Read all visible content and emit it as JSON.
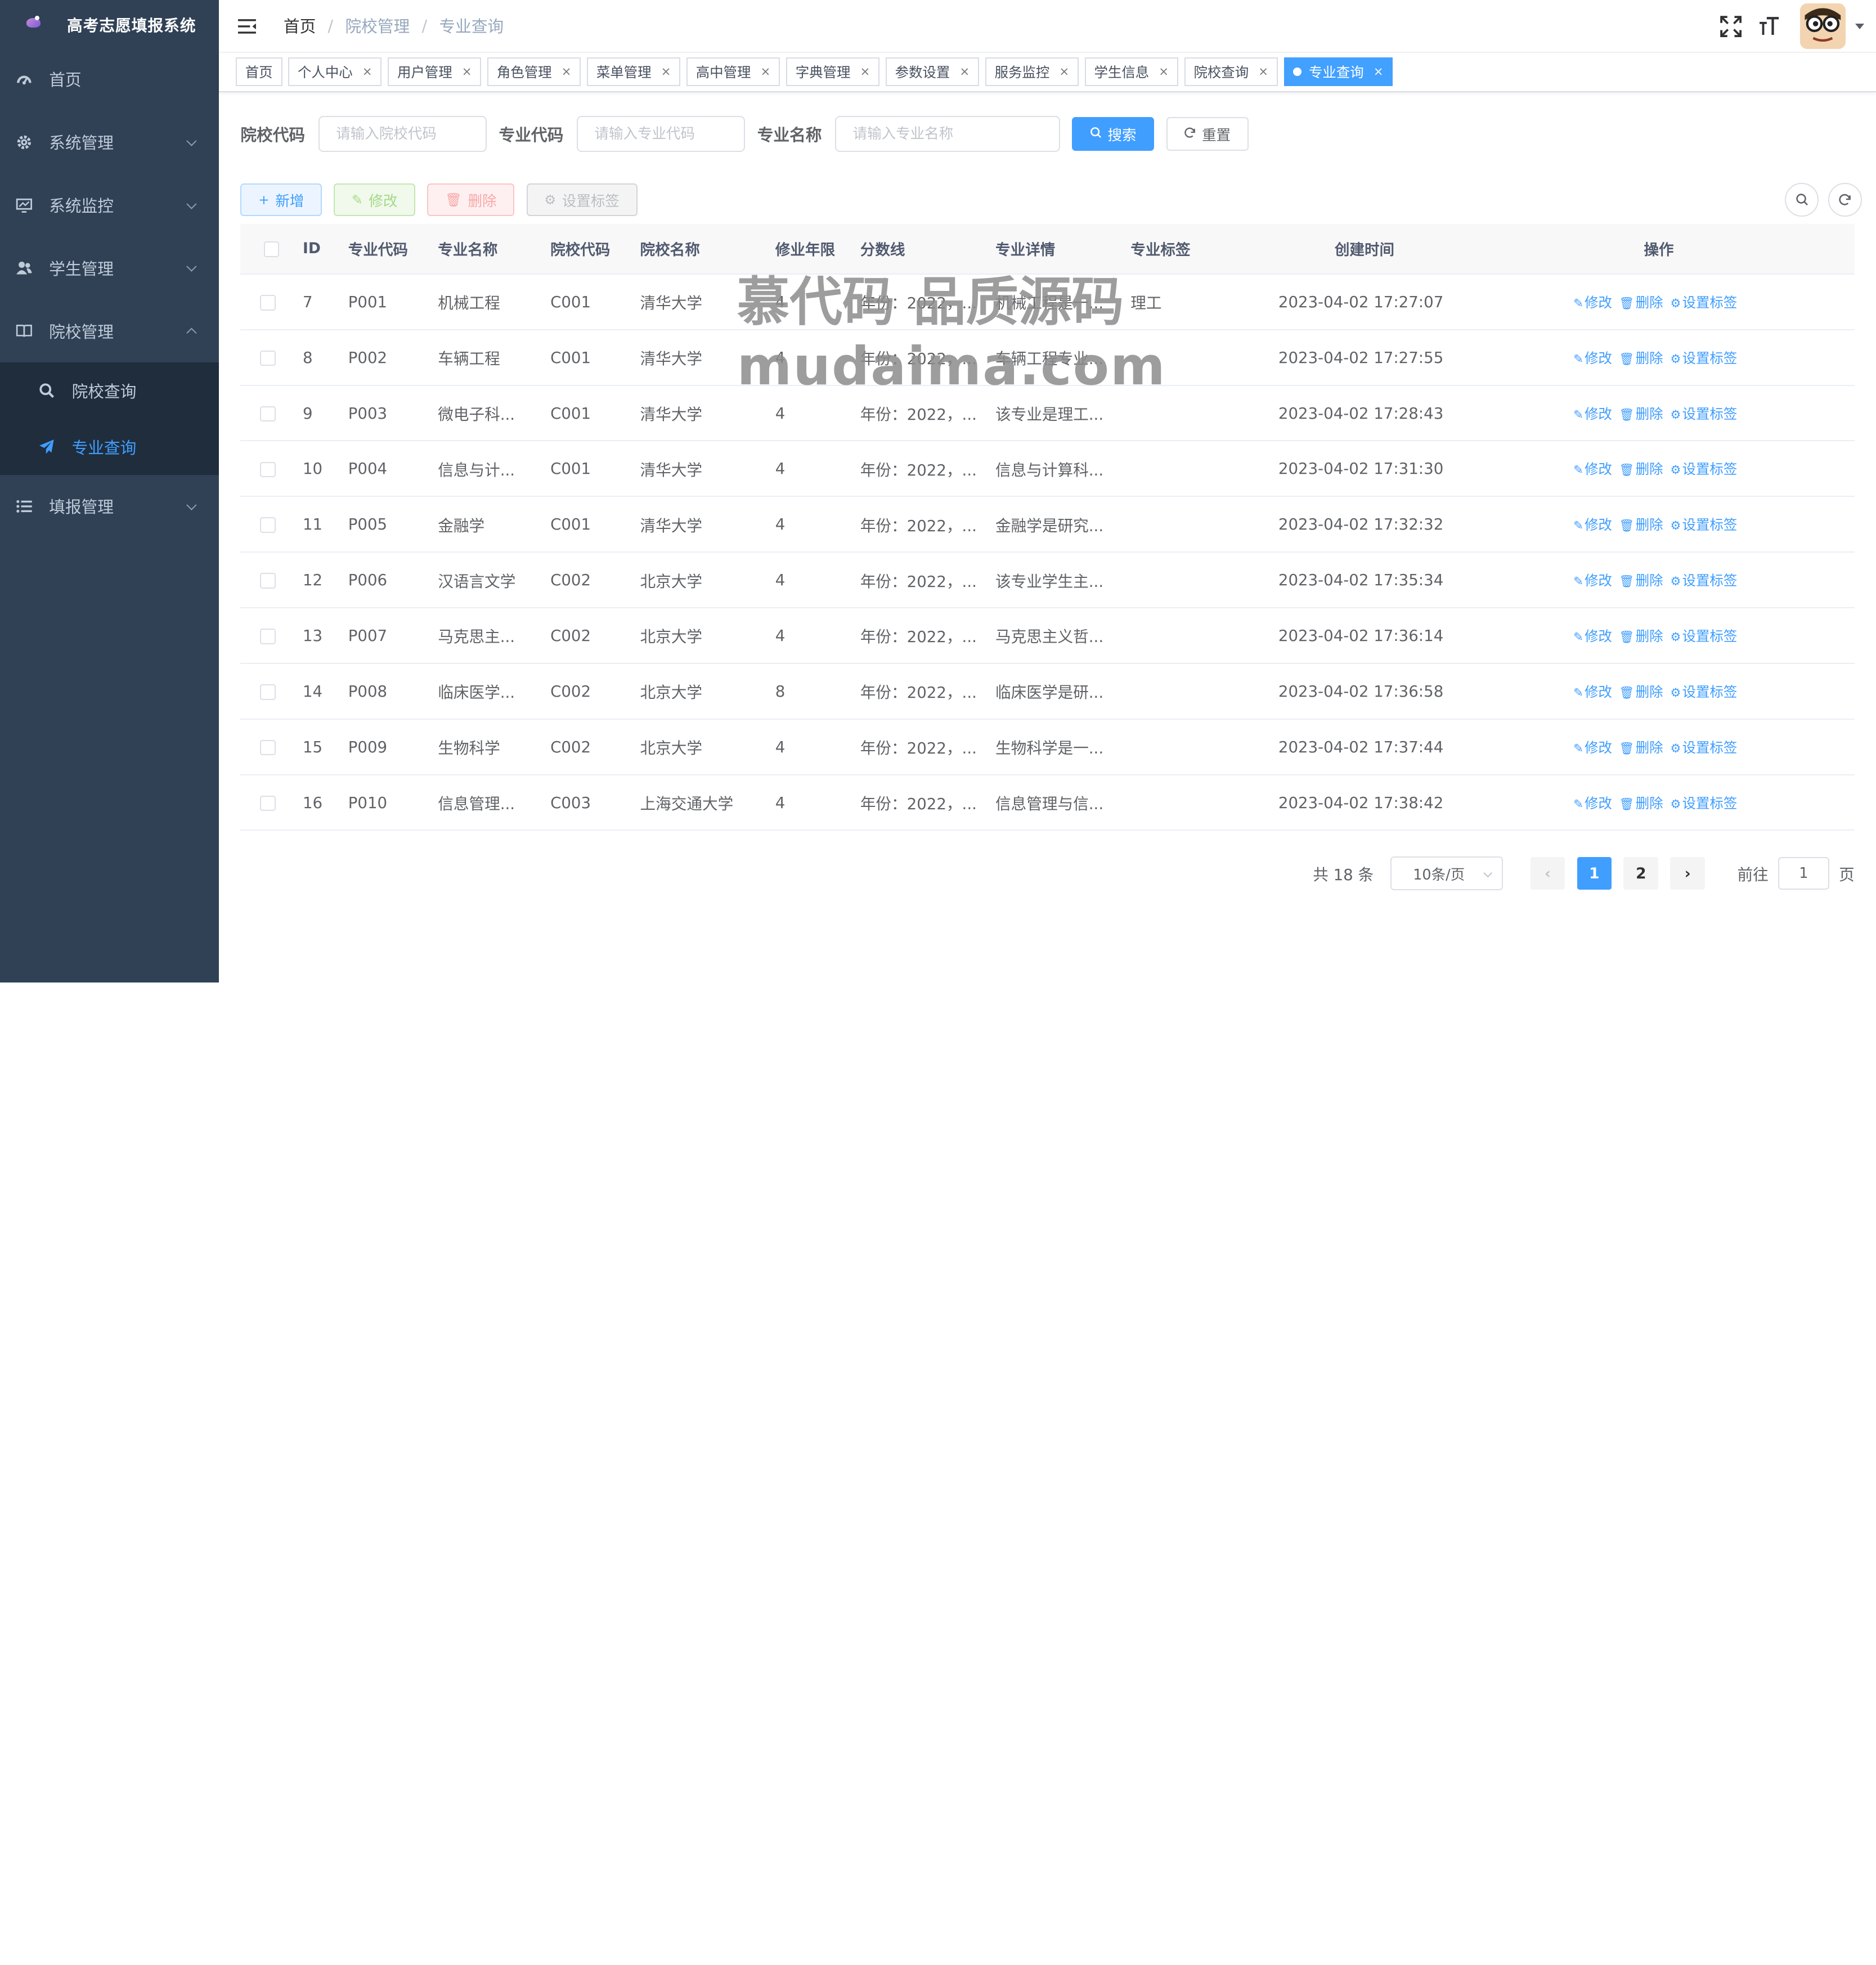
{
  "app": {
    "title": "高考志愿填报系统"
  },
  "sidebar": {
    "items": [
      {
        "label": "首页",
        "icon": "dashboard-icon",
        "has_children": false
      },
      {
        "label": "系统管理",
        "icon": "gear-icon",
        "has_children": true
      },
      {
        "label": "系统监控",
        "icon": "monitor-icon",
        "has_children": true
      },
      {
        "label": "学生管理",
        "icon": "users-icon",
        "has_children": true
      },
      {
        "label": "院校管理",
        "icon": "book-icon",
        "has_children": true,
        "expanded": true
      }
    ],
    "subitems": [
      {
        "label": "院校查询",
        "icon": "search-icon"
      },
      {
        "label": "专业查询",
        "icon": "send-icon",
        "active": true
      }
    ],
    "last_item": {
      "label": "填报管理",
      "icon": "list-icon"
    }
  },
  "breadcrumb": [
    "首页",
    "院校管理",
    "专业查询"
  ],
  "tags": [
    {
      "label": "首页",
      "closable": false
    },
    {
      "label": "个人中心",
      "closable": true
    },
    {
      "label": "用户管理",
      "closable": true
    },
    {
      "label": "角色管理",
      "closable": true
    },
    {
      "label": "菜单管理",
      "closable": true
    },
    {
      "label": "高中管理",
      "closable": true
    },
    {
      "label": "字典管理",
      "closable": true
    },
    {
      "label": "参数设置",
      "closable": true
    },
    {
      "label": "服务监控",
      "closable": true
    },
    {
      "label": "学生信息",
      "closable": true
    },
    {
      "label": "院校查询",
      "closable": true
    },
    {
      "label": "专业查询",
      "closable": true,
      "active": true
    }
  ],
  "search": {
    "school_code_label": "院校代码",
    "school_code_placeholder": "请输入院校代码",
    "major_code_label": "专业代码",
    "major_code_placeholder": "请输入专业代码",
    "major_name_label": "专业名称",
    "major_name_placeholder": "请输入专业名称",
    "search_button": "搜索",
    "reset_button": "重置"
  },
  "toolbar": {
    "add": "新增",
    "edit": "修改",
    "delete": "删除",
    "set_tag": "设置标签"
  },
  "table": {
    "columns": [
      "ID",
      "专业代码",
      "专业名称",
      "院校代码",
      "院校名称",
      "修业年限",
      "分数线",
      "专业详情",
      "专业标签",
      "创建时间",
      "操作"
    ],
    "rows": [
      {
        "id": "7",
        "major_code": "P001",
        "major_name": "机械工程",
        "school_code": "C001",
        "school_name": "清华大学",
        "years": "4",
        "score": "年份：2022，...",
        "detail": "机械工程是一...",
        "tag": "理工",
        "created": "2023-04-02 17:27:07"
      },
      {
        "id": "8",
        "major_code": "P002",
        "major_name": "车辆工程",
        "school_code": "C001",
        "school_name": "清华大学",
        "years": "4",
        "score": "年份：2022，...",
        "detail": "车辆工程专业...",
        "tag": "",
        "created": "2023-04-02 17:27:55"
      },
      {
        "id": "9",
        "major_code": "P003",
        "major_name": "微电子科...",
        "school_code": "C001",
        "school_name": "清华大学",
        "years": "4",
        "score": "年份：2022，...",
        "detail": "该专业是理工...",
        "tag": "",
        "created": "2023-04-02 17:28:43"
      },
      {
        "id": "10",
        "major_code": "P004",
        "major_name": "信息与计...",
        "school_code": "C001",
        "school_name": "清华大学",
        "years": "4",
        "score": "年份：2022，...",
        "detail": "信息与计算科...",
        "tag": "",
        "created": "2023-04-02 17:31:30"
      },
      {
        "id": "11",
        "major_code": "P005",
        "major_name": "金融学",
        "school_code": "C001",
        "school_name": "清华大学",
        "years": "4",
        "score": "年份：2022，...",
        "detail": "金融学是研究...",
        "tag": "",
        "created": "2023-04-02 17:32:32"
      },
      {
        "id": "12",
        "major_code": "P006",
        "major_name": "汉语言文学",
        "school_code": "C002",
        "school_name": "北京大学",
        "years": "4",
        "score": "年份：2022，...",
        "detail": "该专业学生主...",
        "tag": "",
        "created": "2023-04-02 17:35:34"
      },
      {
        "id": "13",
        "major_code": "P007",
        "major_name": "马克思主...",
        "school_code": "C002",
        "school_name": "北京大学",
        "years": "4",
        "score": "年份：2022，...",
        "detail": "马克思主义哲...",
        "tag": "",
        "created": "2023-04-02 17:36:14"
      },
      {
        "id": "14",
        "major_code": "P008",
        "major_name": "临床医学...",
        "school_code": "C002",
        "school_name": "北京大学",
        "years": "8",
        "score": "年份：2022，...",
        "detail": "临床医学是研...",
        "tag": "",
        "created": "2023-04-02 17:36:58"
      },
      {
        "id": "15",
        "major_code": "P009",
        "major_name": "生物科学",
        "school_code": "C002",
        "school_name": "北京大学",
        "years": "4",
        "score": "年份：2022，...",
        "detail": "生物科学是一...",
        "tag": "",
        "created": "2023-04-02 17:37:44"
      },
      {
        "id": "16",
        "major_code": "P010",
        "major_name": "信息管理...",
        "school_code": "C003",
        "school_name": "上海交通大学",
        "years": "4",
        "score": "年份：2022，...",
        "detail": "信息管理与信...",
        "tag": "",
        "created": "2023-04-02 17:38:42"
      }
    ],
    "row_actions": {
      "edit": "修改",
      "delete": "删除",
      "set_tag": "设置标签"
    }
  },
  "pagination": {
    "total": "共 18 条",
    "page_size": "10条/页",
    "pages": [
      "1",
      "2"
    ],
    "current": "1",
    "goto_label": "前往",
    "goto_value": "1",
    "goto_suffix": "页"
  },
  "watermark": {
    "line1": "慕代码 品质源码",
    "line2": "mudaima.com"
  },
  "colors": {
    "sidebar_bg": "#304156",
    "submenu_bg": "#1f2d3d",
    "primary": "#409eff"
  }
}
